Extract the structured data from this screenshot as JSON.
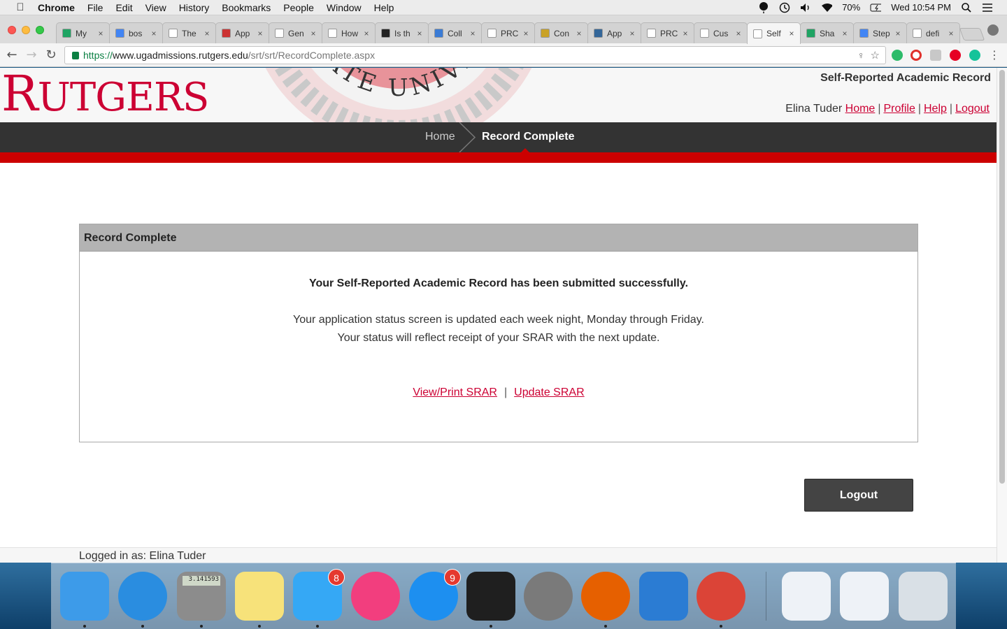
{
  "menubar": {
    "app": "Chrome",
    "items": [
      "File",
      "Edit",
      "View",
      "History",
      "Bookmarks",
      "People",
      "Window",
      "Help"
    ],
    "battery": "70%",
    "clock": "Wed 10:54 PM"
  },
  "tabs": [
    {
      "label": "My",
      "icon": "drive-icon",
      "color": "#1fa463"
    },
    {
      "label": "bos",
      "icon": "docs-icon",
      "color": "#4285f4"
    },
    {
      "label": "The",
      "icon": "ca-icon",
      "color": "#ffffff"
    },
    {
      "label": "App",
      "icon": "shield-icon",
      "color": "#cc3333"
    },
    {
      "label": "Gen",
      "icon": "page-icon",
      "color": "#ffffff"
    },
    {
      "label": "How",
      "icon": "page-icon",
      "color": "#ffffff"
    },
    {
      "label": "Is th",
      "icon": "cb-icon",
      "color": "#222222"
    },
    {
      "label": "Coll",
      "icon": "globe-icon",
      "color": "#3a7bd5"
    },
    {
      "label": "PRC",
      "icon": "page-icon",
      "color": "#ffffff"
    },
    {
      "label": "Con",
      "icon": "crest-icon",
      "color": "#c9a227"
    },
    {
      "label": "App",
      "icon": "shield-icon",
      "color": "#336699"
    },
    {
      "label": "PRC",
      "icon": "page-icon",
      "color": "#ffffff"
    },
    {
      "label": "Cus",
      "icon": "page-icon",
      "color": "#ffffff"
    },
    {
      "label": "Self",
      "icon": "page-icon",
      "color": "#ffffff",
      "active": true
    },
    {
      "label": "Sha",
      "icon": "drive-icon",
      "color": "#1fa463"
    },
    {
      "label": "Step",
      "icon": "docs-icon",
      "color": "#4285f4"
    },
    {
      "label": "defi",
      "icon": "google-icon",
      "color": "#ffffff"
    }
  ],
  "address": {
    "scheme": "https://",
    "host": "www.ugadmissions.rutgers.edu",
    "path": "/srt/srt/RecordComplete.aspx"
  },
  "header": {
    "logo": "RUTGERS",
    "logo_first": "R",
    "logo_rest": "UTGERS",
    "seal_text": "STATE UNIVERSITY",
    "site_title": "Self-Reported Academic Record",
    "user_name": "Elina Tuder",
    "links": [
      "Home",
      "Profile",
      "Help",
      "Logout"
    ]
  },
  "breadcrumb": {
    "home": "Home",
    "current": "Record Complete"
  },
  "panel": {
    "title": "Record Complete",
    "success": "Your Self-Reported Academic Record has been submitted successfully.",
    "status_line1": "Your application status screen is updated each week night, Monday through Friday.",
    "status_line2": "Your status will reflect receipt of your SRAR with the next update.",
    "view_link": "View/Print SRAR",
    "separator": "|",
    "update_link": "Update SRAR"
  },
  "logout_button": "Logout",
  "footer": {
    "logged_in": "Logged in as: Elina Tuder"
  },
  "dock": [
    {
      "name": "finder-icon",
      "color": "#3d9be9"
    },
    {
      "name": "safari-icon",
      "color": "#2a8de0"
    },
    {
      "name": "calculator-icon",
      "color": "#8c8c8c",
      "text": "3.141593"
    },
    {
      "name": "notes-icon",
      "color": "#f7e27a"
    },
    {
      "name": "messages-icon",
      "color": "#35a8f5",
      "badge": "8"
    },
    {
      "name": "itunes-icon",
      "color": "#f23e7e"
    },
    {
      "name": "app-store-icon",
      "color": "#1d8ff0",
      "badge": "9"
    },
    {
      "name": "activity-monitor-icon",
      "color": "#1f1f1f"
    },
    {
      "name": "system-preferences-icon",
      "color": "#7a7a7a"
    },
    {
      "name": "firefox-icon",
      "color": "#e66000"
    },
    {
      "name": "word-icon",
      "color": "#2b7cd3"
    },
    {
      "name": "chrome-icon",
      "color": "#db4437"
    },
    {
      "name": "word-document-1-icon",
      "color": "#eef2f7"
    },
    {
      "name": "word-document-2-icon",
      "color": "#eef2f7"
    },
    {
      "name": "trash-icon",
      "color": "#d9e0e6"
    }
  ]
}
